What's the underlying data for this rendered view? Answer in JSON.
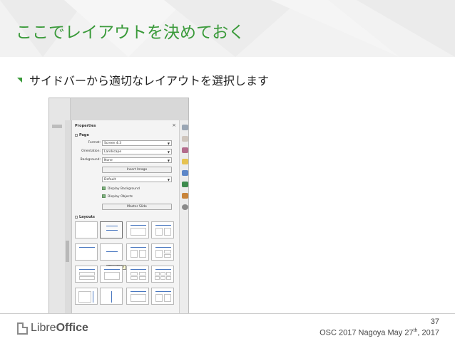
{
  "slide": {
    "title": "ここでレイアウトを決めておく",
    "bullet": "サイドバーから適切なレイアウトを選択します",
    "page_number": "37",
    "footer_event_pre": "OSC 2017 Nagoya May 27",
    "footer_event_sup": "th",
    "footer_event_post": ", 2017",
    "logo_libre": "Libre",
    "logo_office": "Office"
  },
  "sidebar": {
    "title": "Properties",
    "close_label": "×",
    "page_section": "Page",
    "format_label": "Format:",
    "format_value": "Screen 4:3",
    "orientation_label": "Orientation:",
    "orientation_value": "Landscape",
    "background_label": "Background:",
    "background_value": "None",
    "insert_image": "Insert Image",
    "default_value": "Default",
    "display_background": "Display Background",
    "display_objects": "Display Objects",
    "master_slide": "Master Slide",
    "layouts_section": "Layouts",
    "tooltip": "Title Slide",
    "combo_arrow": "▼"
  },
  "colors": {
    "accent": "#3a9a3a",
    "layout_line": "#4a78c0"
  }
}
